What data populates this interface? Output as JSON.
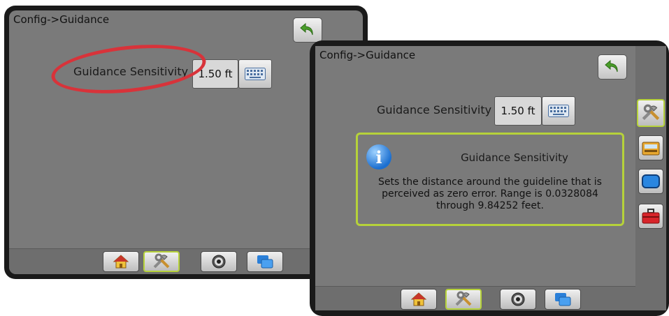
{
  "screen_left": {
    "breadcrumb": "Config->Guidance",
    "setting": {
      "label": "Guidance Sensitivity",
      "value": "1.50 ft"
    },
    "bottom_nav": [
      "home-icon",
      "tools-icon",
      "gps-icon",
      "layers-icon"
    ],
    "active_nav": "tools-icon",
    "annotation": "red-ellipse-highlight"
  },
  "screen_right": {
    "breadcrumb": "Config->Guidance",
    "setting": {
      "label": "Guidance Sensitivity",
      "value": "1.50 ft"
    },
    "info_popup": {
      "title": "Guidance Sensitivity",
      "body": "Sets the distance around the guideline that is perceived as zero error. Range is 0.0328084 through 9.84252 feet."
    },
    "side_tabs": [
      "tools-icon",
      "console-icon",
      "display-icon",
      "toolbox-icon"
    ],
    "active_side_tab": "tools-icon",
    "bottom_nav": [
      "home-icon",
      "tools-icon",
      "gps-icon",
      "layers-icon"
    ],
    "active_nav": "tools-icon"
  },
  "colors": {
    "screen_bg": "#7a7a7a",
    "active_border": "#b6d23a",
    "highlight_red": "#d8333a",
    "back_arrow": "#4a9e2a"
  }
}
